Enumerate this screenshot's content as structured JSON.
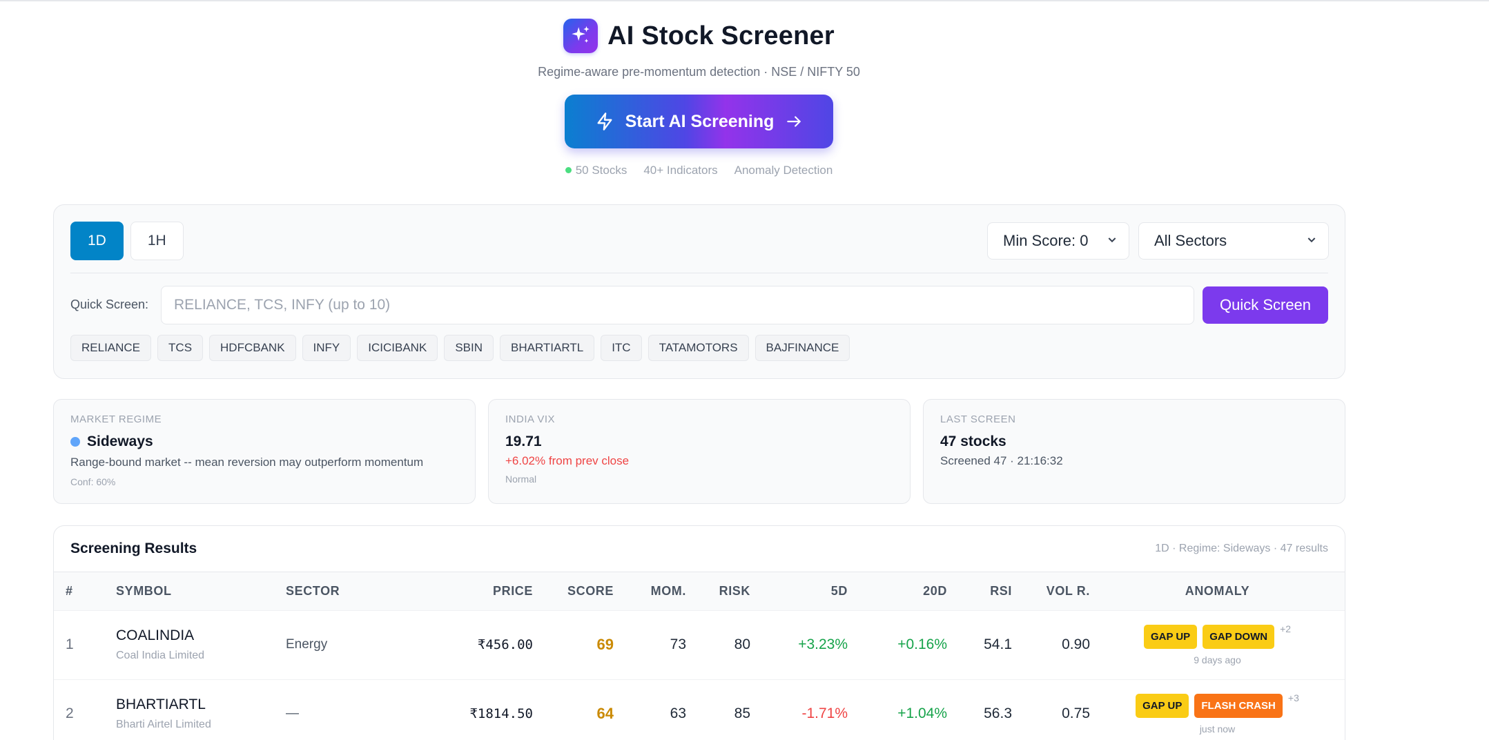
{
  "header": {
    "title": "AI Stock Screener",
    "subtitle": "Regime-aware pre-momentum detection · NSE / NIFTY 50",
    "cta_label": "Start AI Screening",
    "stats": [
      "50 Stocks",
      "40+ Indicators",
      "Anomaly Detection"
    ]
  },
  "controls": {
    "timeframes": [
      {
        "label": "1D",
        "active": true
      },
      {
        "label": "1H",
        "active": false
      }
    ],
    "min_score": "Min Score: 0",
    "sector": "All Sectors",
    "quick_screen_label": "Quick Screen:",
    "quick_screen_placeholder": "RELIANCE, TCS, INFY  (up to 10)",
    "quick_screen_button": "Quick Screen",
    "chips": [
      "RELIANCE",
      "TCS",
      "HDFCBANK",
      "INFY",
      "ICICIBANK",
      "SBIN",
      "BHARTIARTL",
      "ITC",
      "TATAMOTORS",
      "BAJFINANCE"
    ]
  },
  "cards": {
    "regime": {
      "label": "MARKET REGIME",
      "value": "Sideways",
      "description": "Range-bound market -- mean reversion may outperform momentum",
      "confidence": "Conf: 60%"
    },
    "vix": {
      "label": "INDIA VIX",
      "value": "19.71",
      "change": "+6.02% from prev close",
      "status": "Normal"
    },
    "last_screen": {
      "label": "LAST SCREEN",
      "value": "47 stocks",
      "detail": "Screened 47 · 21:16:32"
    }
  },
  "results": {
    "title": "Screening Results",
    "meta": "1D · Regime: Sideways · 47 results",
    "columns": [
      "#",
      "SYMBOL",
      "SECTOR",
      "PRICE",
      "SCORE",
      "MOM.",
      "RISK",
      "5D",
      "20D",
      "RSI",
      "VOL R.",
      "ANOMALY"
    ],
    "rows": [
      {
        "rank": "1",
        "symbol": "COALINDIA",
        "name": "Coal India Limited",
        "sector": "Energy",
        "price": "₹456.00",
        "score": "69",
        "mom": "73",
        "risk": "80",
        "d5": "+3.23%",
        "d20": "+0.16%",
        "rsi": "54.1",
        "vol": "0.90",
        "badges": [
          "GAP UP",
          "GAP DOWN"
        ],
        "more": "+2",
        "ago": "9 days ago"
      },
      {
        "rank": "2",
        "symbol": "BHARTIARTL",
        "name": "Bharti Airtel Limited",
        "sector": "—",
        "price": "₹1814.50",
        "score": "64",
        "mom": "63",
        "risk": "85",
        "d5": "-1.71%",
        "d20": "+1.04%",
        "rsi": "56.3",
        "vol": "0.75",
        "badges": [
          "GAP UP",
          "FLASH CRASH"
        ],
        "more": "+3",
        "ago": "just now"
      }
    ]
  }
}
